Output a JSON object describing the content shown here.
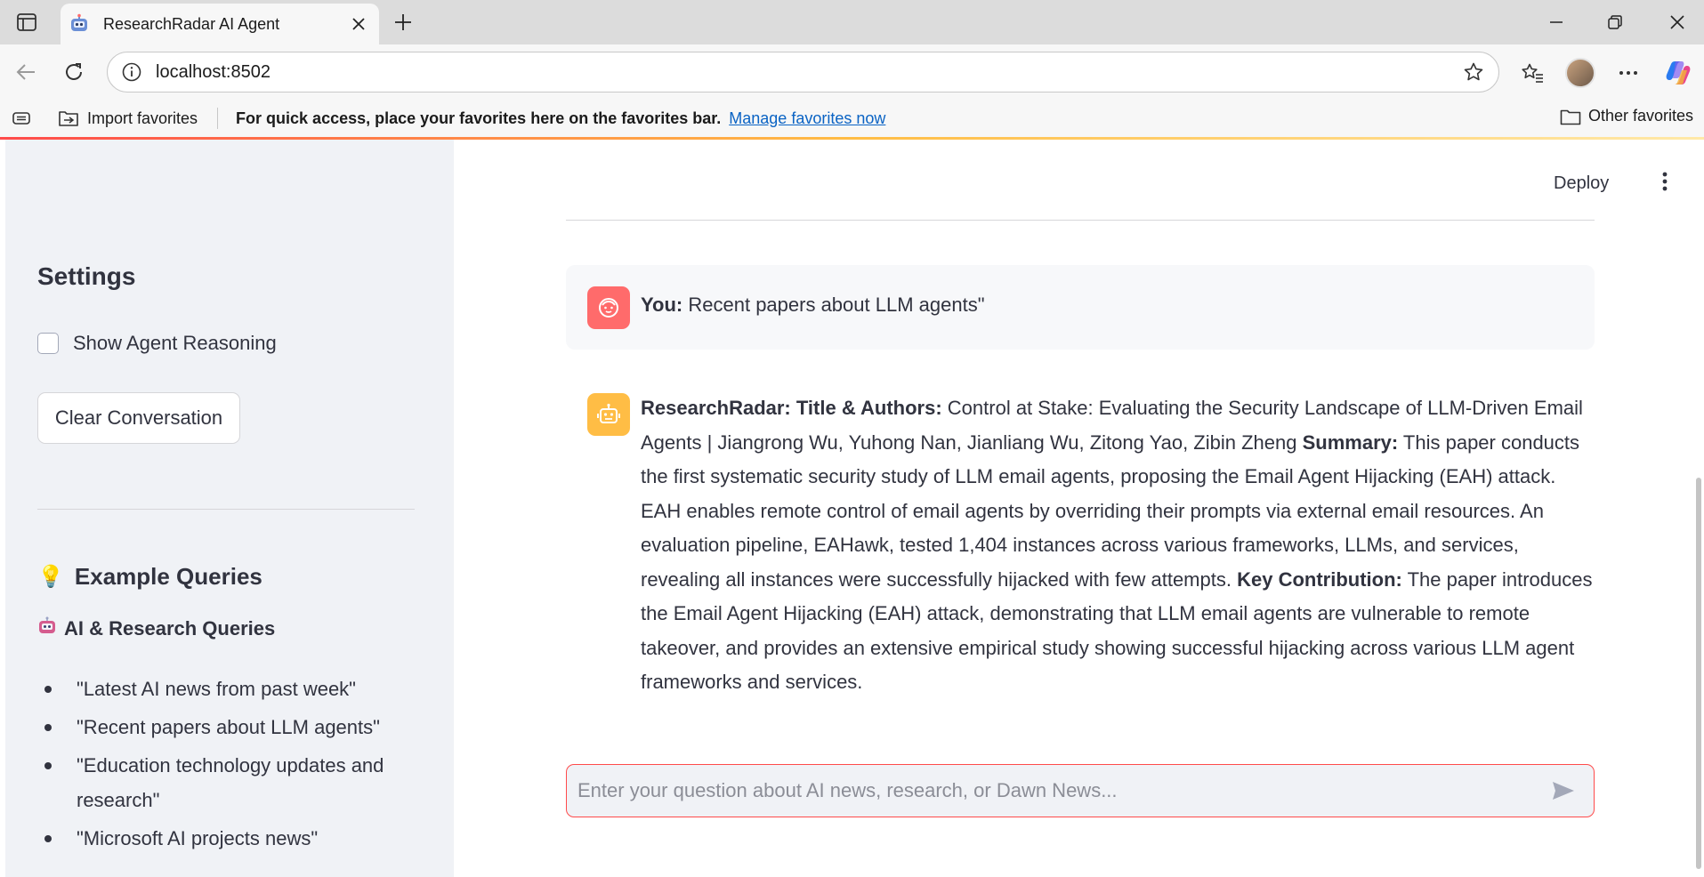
{
  "browser": {
    "tab_title": "ResearchRadar AI Agent",
    "url": "localhost:8502",
    "favorites_bar": {
      "import_label": "Import favorites",
      "prompt_text": "For quick access, place your favorites here on the favorites bar.",
      "manage_link": "Manage favorites now",
      "other_label": "Other favorites"
    }
  },
  "sidebar": {
    "settings_title": "Settings",
    "show_reasoning_label": "Show Agent Reasoning",
    "show_reasoning_checked": false,
    "clear_button": "Clear Conversation",
    "examples_title": "Example Queries",
    "examples_icon": "lightbulb-icon",
    "category_title": "AI & Research Queries",
    "category_icon": "robot-icon",
    "queries": [
      "\"Latest AI news from past week\"",
      "\"Recent papers about LLM agents\"",
      "\"Education technology updates and research\"",
      "\"Microsoft AI projects news\""
    ]
  },
  "main": {
    "deploy_label": "Deploy",
    "user_message": {
      "speaker": "You:",
      "text": "Recent papers about LLM agents\""
    },
    "bot_message": {
      "speaker": "ResearchRadar:",
      "title_label": "Title & Authors:",
      "title_text": "Control at Stake: Evaluating the Security Landscape of LLM-Driven Email Agents | Jiangrong Wu, Yuhong Nan, Jianliang Wu, Zitong Yao, Zibin Zheng",
      "summary_label": "Summary:",
      "summary_text": "This paper conducts the first systematic security study of LLM email agents, proposing the Email Agent Hijacking (EAH) attack. EAH enables remote control of email agents by overriding their prompts via external email resources. An evaluation pipeline, EAHawk, tested 1,404 instances across various frameworks, LLMs, and services, revealing all instances were successfully hijacked with few attempts.",
      "contribution_label": "Key Contribution:",
      "contribution_text": "The paper introduces the Email Agent Hijacking (EAH) attack, demonstrating that LLM email agents are vulnerable to remote takeover, and provides an extensive empirical study showing successful hijacking across various LLM agent frameworks and services."
    },
    "chat_input_placeholder": "Enter your question about AI news, research, or Dawn News..."
  },
  "colors": {
    "accent": "#ff4b4b",
    "user_avatar": "#ff6b6b",
    "bot_avatar": "#ffbd45",
    "sidebar_bg": "#f0f2f6",
    "link": "#0a63c4"
  }
}
